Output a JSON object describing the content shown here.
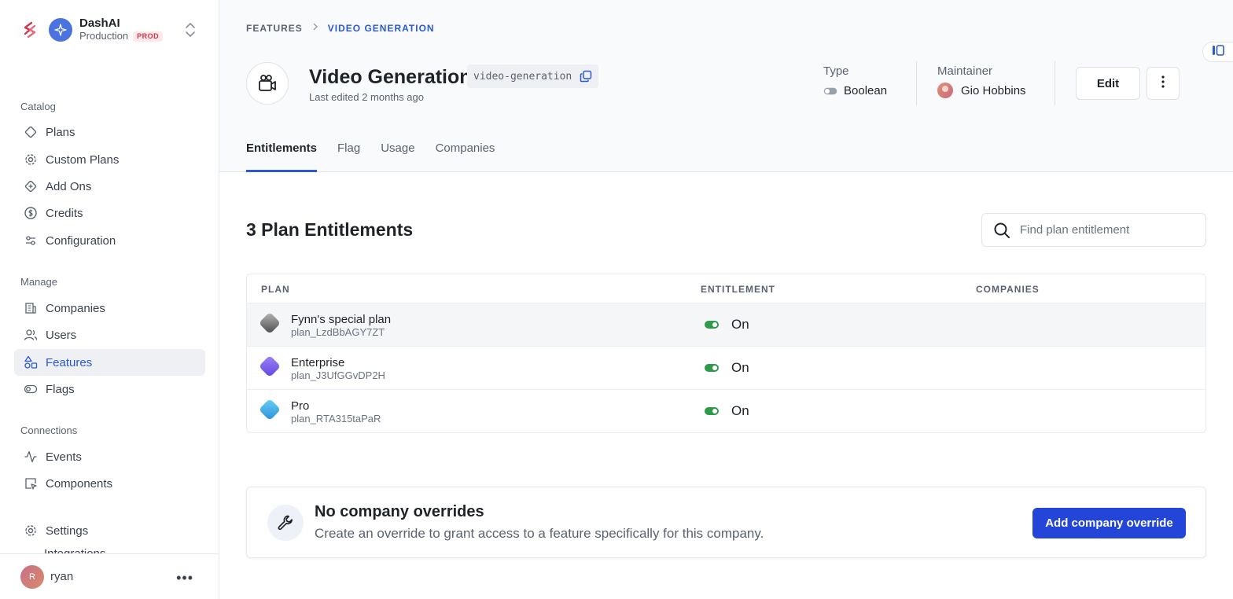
{
  "org": {
    "name": "DashAI",
    "environment": "Production",
    "env_badge": "PROD"
  },
  "sidebar": {
    "catalog_label": "Catalog",
    "catalog_items": [
      {
        "label": "Plans",
        "icon": "diamond-icon"
      },
      {
        "label": "Custom Plans",
        "icon": "gear-icon"
      },
      {
        "label": "Add Ons",
        "icon": "addon-diamond-icon"
      },
      {
        "label": "Credits",
        "icon": "dollar-circle-icon"
      },
      {
        "label": "Configuration",
        "icon": "sliders-icon"
      }
    ],
    "manage_label": "Manage",
    "manage_items": [
      {
        "label": "Companies",
        "icon": "building-icon"
      },
      {
        "label": "Users",
        "icon": "users-icon"
      },
      {
        "label": "Features",
        "icon": "shapes-icon",
        "active": true
      },
      {
        "label": "Flags",
        "icon": "toggle-icon"
      }
    ],
    "connections_label": "Connections",
    "connections_items": [
      {
        "label": "Events",
        "icon": "activity-icon"
      },
      {
        "label": "Components",
        "icon": "component-icon"
      }
    ],
    "settings_label": "Settings",
    "partial_item": "Integrations",
    "user": {
      "initial": "R",
      "name": "ryan"
    }
  },
  "breadcrumb": {
    "parent": "FEATURES",
    "current": "VIDEO GENERATION"
  },
  "feature": {
    "title": "Video Generation",
    "key": "video-generation",
    "last_edited": "Last edited 2 months ago",
    "type_label": "Type",
    "type_value": "Boolean",
    "maintainer_label": "Maintainer",
    "maintainer_value": "Gio Hobbins"
  },
  "actions": {
    "edit": "Edit"
  },
  "tabs": [
    {
      "label": "Entitlements",
      "active": true
    },
    {
      "label": "Flag"
    },
    {
      "label": "Usage"
    },
    {
      "label": "Companies"
    }
  ],
  "entitlements": {
    "heading": "3 Plan Entitlements",
    "search_placeholder": "Find plan entitlement",
    "columns": {
      "plan": "PLAN",
      "entitlement": "ENTITLEMENT",
      "companies": "COMPANIES"
    },
    "rows": [
      {
        "name": "Fynn's special plan",
        "id": "plan_LzdBbAGY7ZT",
        "value": "On",
        "color": "#6e6e6e"
      },
      {
        "name": "Enterprise",
        "id": "plan_J3UfGGvDP2H",
        "value": "On",
        "color": "#7b5cf0"
      },
      {
        "name": "Pro",
        "id": "plan_RTA315taPaR",
        "value": "On",
        "color": "#3aa7e8"
      }
    ]
  },
  "overrides": {
    "title": "No company overrides",
    "description": "Create an override to grant access to a feature specifically for this company.",
    "button": "Add company override"
  },
  "colors": {
    "accent": "#2a58d6",
    "primary_button": "#2446d8",
    "toggle_on": "#2f9a4a",
    "prod_badge": "#d0364c"
  }
}
